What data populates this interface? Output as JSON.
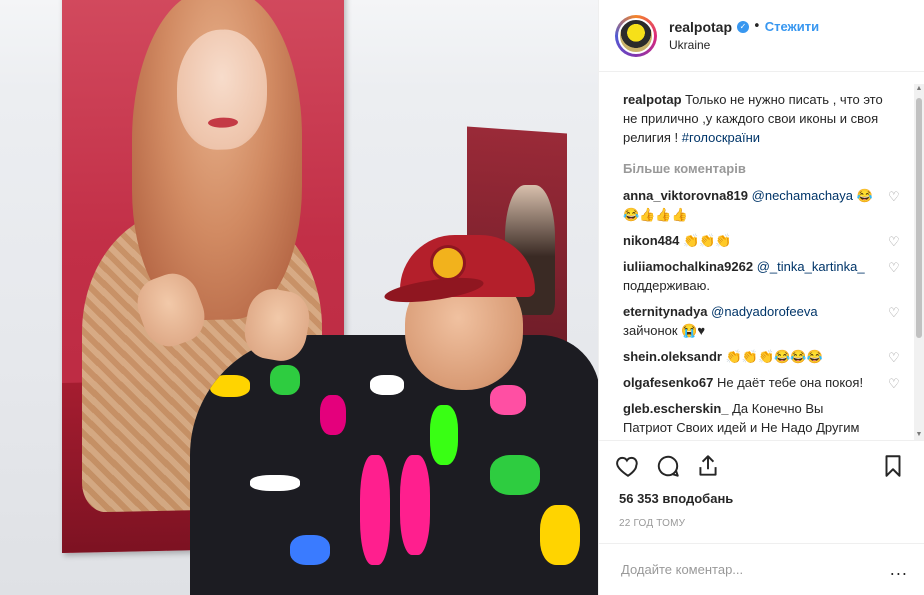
{
  "header": {
    "username": "realpotap",
    "verified_icon": "verified-badge-icon",
    "separator": "•",
    "follow_label": "Стежити",
    "location": "Ukraine"
  },
  "caption": {
    "username": "realpotap",
    "text": "Только не нужно писать , что это не прилично ,у каждого свои иконы и своя религия ! ",
    "hashtag": "#голоскраїни"
  },
  "more_comments_label": "Більше коментарів",
  "comments": [
    {
      "username": "anna_viktorovna819",
      "mention": "@nechamachaya",
      "text": "😂😂👍👍👍",
      "like_icon": "heart-icon"
    },
    {
      "username": "nikon484",
      "mention": "",
      "text": "👏👏👏",
      "like_icon": "heart-icon"
    },
    {
      "username": "iuliiamochalkina9262",
      "mention": "@_tinka_kartinka_",
      "text": "поддерживаю.",
      "like_icon": "heart-icon"
    },
    {
      "username": "eternitynadya",
      "mention": "@nadyadorofeeva",
      "text": "зайчонок 😭♥",
      "like_icon": "heart-icon"
    },
    {
      "username": "shein.oleksandr",
      "mention": "",
      "text": "👏👏👏😂😂😂",
      "like_icon": "heart-icon"
    },
    {
      "username": "olgafesenko67",
      "mention": "",
      "text": "Не даёт тебе она покоя!",
      "like_icon": "heart-icon"
    },
    {
      "username": "gleb.escherskin_",
      "mention": "",
      "text": "Да Конечно Вы Патриот Своих идей и Не Надо Другим Навязывать вы Просто Гений. Завтра У Меня Ден",
      "like_icon": ""
    }
  ],
  "actions": {
    "like_icon": "heart-outline-icon",
    "comment_icon": "comment-bubble-icon",
    "share_icon": "share-arrow-icon",
    "save_icon": "bookmark-icon"
  },
  "likes_label": "56 353 вподобань",
  "time_label": "22 ГОД ТОМУ",
  "add_comment": {
    "placeholder": "Додайте коментар...",
    "value": ""
  },
  "more_options": "...",
  "scrollbar": {
    "up": "▲",
    "down": "▼"
  },
  "colors": {
    "link": "#3897f0",
    "hashtag": "#003569",
    "muted": "#999999",
    "text": "#262626"
  }
}
